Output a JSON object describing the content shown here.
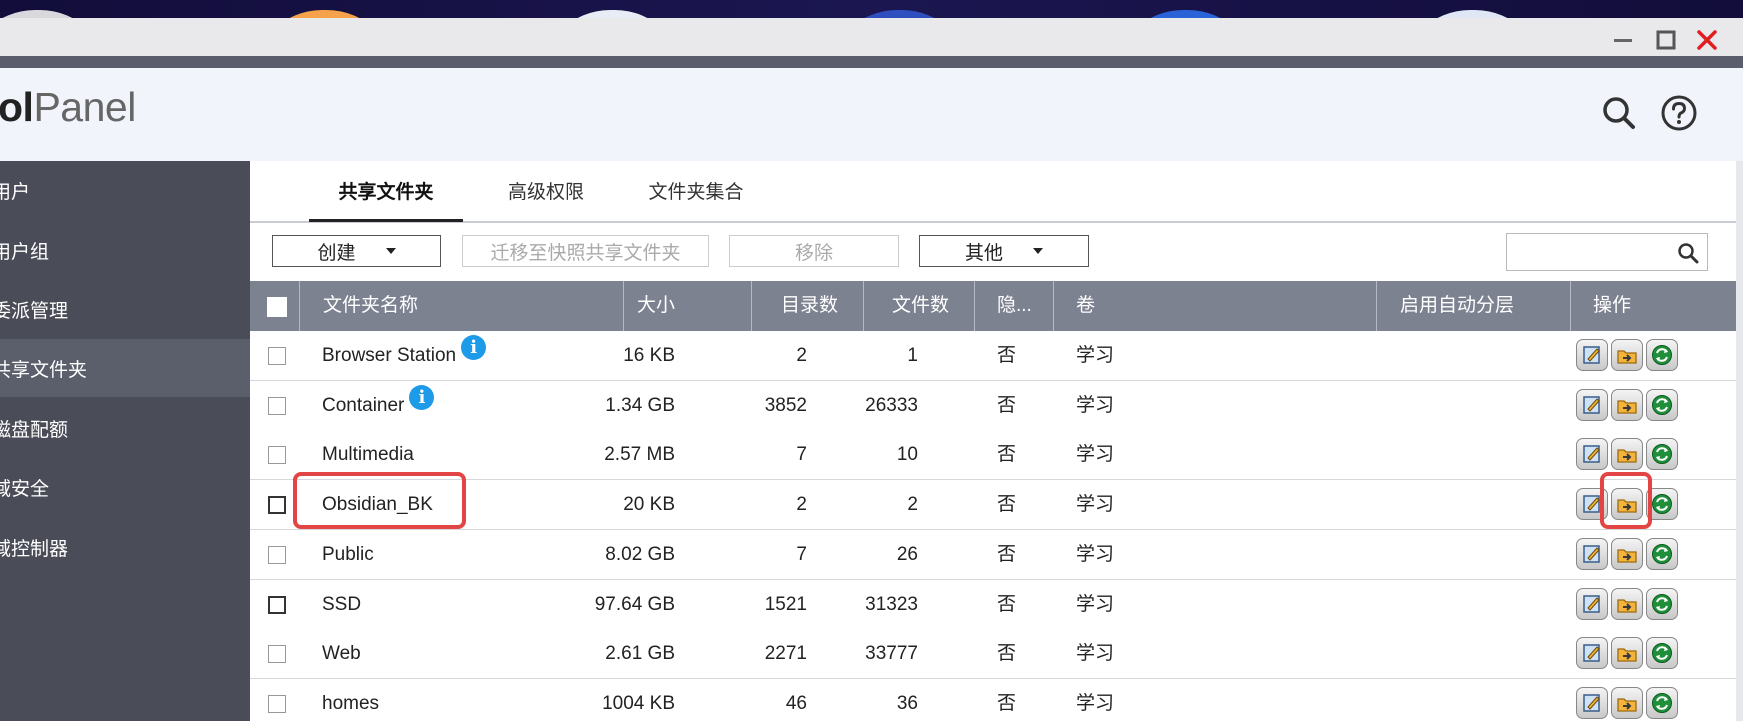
{
  "window": {
    "controls": {
      "minimize": "minimize-icon",
      "maximize": "maximize-icon",
      "close": "close-icon"
    }
  },
  "header": {
    "logo_bold": "ol",
    "logo_normal": "Panel",
    "icons": [
      "search-icon",
      "help-icon"
    ]
  },
  "sidebar": {
    "items": [
      {
        "label": "用户"
      },
      {
        "label": "用户组"
      },
      {
        "label": "委派管理"
      },
      {
        "label": "共享文件夹",
        "active": true
      },
      {
        "label": "磁盘配额"
      },
      {
        "label": "域安全"
      },
      {
        "label": "域控制器"
      }
    ]
  },
  "tabs": [
    {
      "label": "共享文件夹",
      "active": true
    },
    {
      "label": "高级权限"
    },
    {
      "label": "文件夹集合"
    }
  ],
  "toolbar": {
    "create_label": "创建",
    "migrate_label": "迁移至快照共享文件夹",
    "remove_label": "移除",
    "other_label": "其他",
    "search_placeholder": ""
  },
  "table": {
    "columns": [
      "文件夹名称",
      "大小",
      "目录数",
      "文件数",
      "隐...",
      "卷",
      "启用自动分层",
      "操作"
    ],
    "rows": [
      {
        "name": "Browser Station",
        "info": true,
        "size": "16 KB",
        "dirs": "2",
        "files": "1",
        "hidden": "否",
        "volume": "学习",
        "tiering": ""
      },
      {
        "name": "Container",
        "info": true,
        "size": "1.34 GB",
        "dirs": "3852",
        "files": "26333",
        "hidden": "否",
        "volume": "学习",
        "tiering": ""
      },
      {
        "name": "Multimedia",
        "info": false,
        "size": "2.57 MB",
        "dirs": "7",
        "files": "10",
        "hidden": "否",
        "volume": "学习",
        "tiering": ""
      },
      {
        "name": "Obsidian_BK",
        "info": false,
        "size": "20 KB",
        "dirs": "2",
        "files": "2",
        "hidden": "否",
        "volume": "学习",
        "tiering": "",
        "highlighted": true
      },
      {
        "name": "Public",
        "info": false,
        "size": "8.02 GB",
        "dirs": "7",
        "files": "26",
        "hidden": "否",
        "volume": "学习",
        "tiering": ""
      },
      {
        "name": "SSD",
        "info": false,
        "size": "97.64 GB",
        "dirs": "1521",
        "files": "31323",
        "hidden": "否",
        "volume": "学习",
        "tiering": ""
      },
      {
        "name": "Web",
        "info": false,
        "size": "2.61 GB",
        "dirs": "2271",
        "files": "33777",
        "hidden": "否",
        "volume": "学习",
        "tiering": ""
      },
      {
        "name": "homes",
        "info": false,
        "size": "1004 KB",
        "dirs": "46",
        "files": "36",
        "hidden": "否",
        "volume": "学习",
        "tiering": ""
      }
    ],
    "info_glyph": "i",
    "action_icons": [
      "edit-properties-icon",
      "edit-permissions-icon",
      "refresh-icon"
    ]
  },
  "colors": {
    "header_bg": "#f1f4fb",
    "sidebar_bg": "#4a4c58",
    "table_header_bg": "#7d8291",
    "highlight": "#e34545",
    "info": "#1e9be8",
    "close": "#e02020"
  }
}
